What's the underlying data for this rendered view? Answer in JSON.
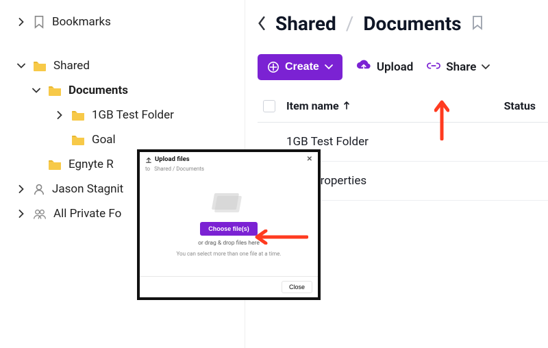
{
  "sidebar": {
    "bookmarks_label": "Bookmarks",
    "items": [
      {
        "label": "Shared"
      },
      {
        "label": "Documents"
      },
      {
        "label": "1GB Test Folder"
      },
      {
        "label": "Goal"
      },
      {
        "label": "Egnyte R"
      },
      {
        "label": "Jason Stagnit"
      },
      {
        "label": "All Private Fo"
      }
    ]
  },
  "header": {
    "crumb1": "Shared",
    "slash": "/",
    "crumb2": "Documents"
  },
  "toolbar": {
    "create_label": "Create",
    "upload_label": "Upload",
    "share_label": "Share"
  },
  "table": {
    "header_item": "Item name",
    "header_status": "Status",
    "rows": [
      "1GB Test Folder",
      "Goal Properties"
    ]
  },
  "dialog": {
    "title": "Upload files",
    "to_prefix": "to",
    "to_path": "Shared / Documents",
    "choose_label": "Choose file(s)",
    "drag_text": "or drag & drop files here",
    "multi_text": "You can select more than one file at a time.",
    "close_label": "Close"
  },
  "colors": {
    "accent": "#7b22d3",
    "folder": "#f7c948",
    "annotation": "#ff3b20"
  }
}
